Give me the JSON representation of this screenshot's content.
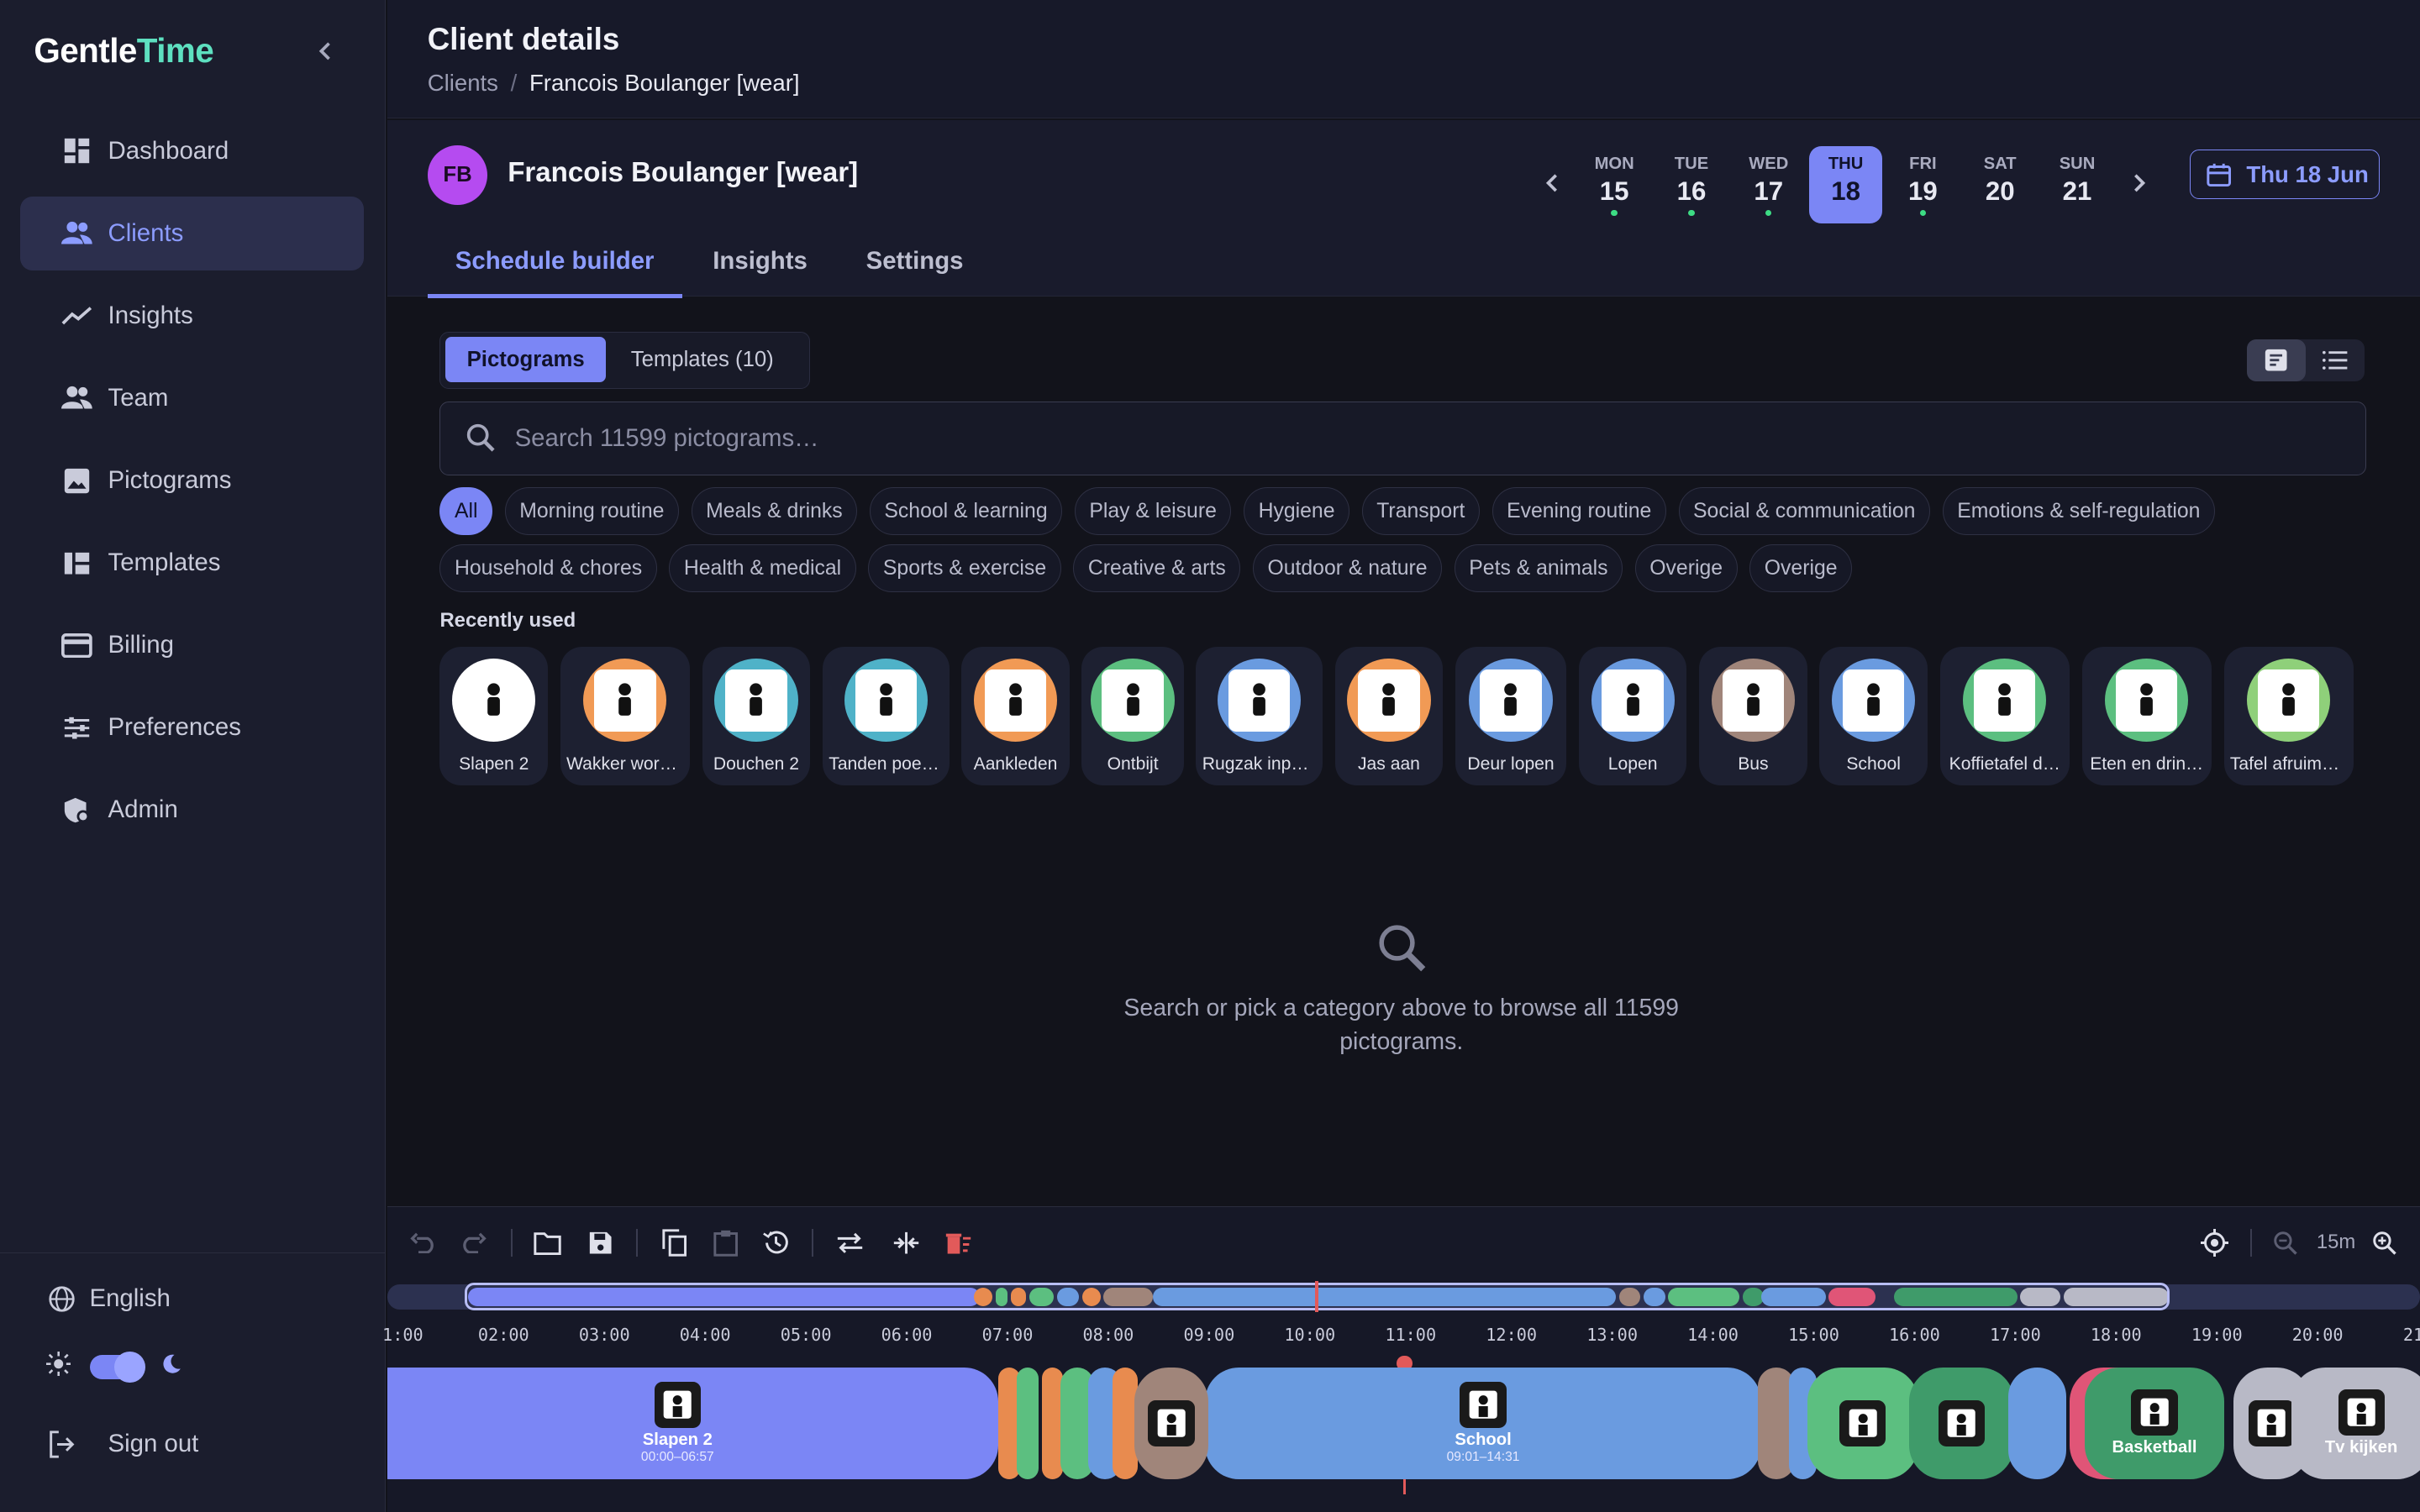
{
  "app": {
    "logo_part1": "Gentle",
    "logo_part2": "Time"
  },
  "sidebar": {
    "items": [
      {
        "label": "Dashboard",
        "icon": "dashboard-icon"
      },
      {
        "label": "Clients",
        "icon": "clients-icon",
        "active": true
      },
      {
        "label": "Insights",
        "icon": "insights-icon"
      },
      {
        "label": "Team",
        "icon": "team-icon"
      },
      {
        "label": "Pictograms",
        "icon": "image-icon"
      },
      {
        "label": "Templates",
        "icon": "templates-icon"
      },
      {
        "label": "Billing",
        "icon": "billing-icon"
      },
      {
        "label": "Preferences",
        "icon": "preferences-icon"
      },
      {
        "label": "Admin",
        "icon": "admin-icon"
      }
    ],
    "language": "English",
    "sign_out": "Sign out"
  },
  "header": {
    "title": "Client details",
    "breadcrumb": {
      "root": "Clients",
      "separator": "/",
      "current": "Francois Boulanger [wear]"
    }
  },
  "client": {
    "initials": "FB",
    "name": "Francois Boulanger [wear]",
    "days": [
      {
        "dow": "MON",
        "num": "15",
        "dot": true
      },
      {
        "dow": "TUE",
        "num": "16",
        "dot": true
      },
      {
        "dow": "WED",
        "num": "17",
        "dot": true
      },
      {
        "dow": "THU",
        "num": "18",
        "dot": false,
        "selected": true
      },
      {
        "dow": "FRI",
        "num": "19",
        "dot": true
      },
      {
        "dow": "SAT",
        "num": "20",
        "dot": false
      },
      {
        "dow": "SUN",
        "num": "21",
        "dot": false
      }
    ],
    "date_button": "Thu 18 Jun",
    "tabs": [
      "Schedule builder",
      "Insights",
      "Settings"
    ]
  },
  "builder": {
    "seg_pictograms": "Pictograms",
    "seg_templates": "Templates (10)",
    "search_placeholder": "Search 11599 pictograms…",
    "categories": [
      "All",
      "Morning routine",
      "Meals & drinks",
      "School & learning",
      "Play & leisure",
      "Hygiene",
      "Transport",
      "Evening routine",
      "Social & communication",
      "Emotions & self-regulation",
      "Household & chores",
      "Health & medical",
      "Sports & exercise",
      "Creative & arts",
      "Outdoor & nature",
      "Pets & animals",
      "Overige",
      "Overige"
    ],
    "recent_label": "Recently used",
    "recent": [
      {
        "label": "Slapen 2",
        "color": "#ffffff"
      },
      {
        "label": "Wakker word…",
        "color": "#f19a55"
      },
      {
        "label": "Douchen 2",
        "color": "#4fb2c8"
      },
      {
        "label": "Tanden poet…",
        "color": "#4fb2c8"
      },
      {
        "label": "Aankleden",
        "color": "#f19a55"
      },
      {
        "label": "Ontbijt",
        "color": "#5cbf80"
      },
      {
        "label": "Rugzak inpa…",
        "color": "#6a9be0"
      },
      {
        "label": "Jas aan",
        "color": "#f19a55"
      },
      {
        "label": "Deur lopen",
        "color": "#6a9be0"
      },
      {
        "label": "Lopen",
        "color": "#6a9be0"
      },
      {
        "label": "Bus",
        "color": "#a0857a"
      },
      {
        "label": "School",
        "color": "#6a9be0"
      },
      {
        "label": "Koffietafel d…",
        "color": "#5cbf80"
      },
      {
        "label": "Eten en drin…",
        "color": "#5cbf80"
      },
      {
        "label": "Tafel afruime…",
        "color": "#8fd07a"
      }
    ],
    "empty_text": "Search or pick a category above to browse all 11599 pictograms."
  },
  "timeline": {
    "zoom": "15m",
    "hours": [
      "1:00",
      "02:00",
      "03:00",
      "04:00",
      "05:00",
      "06:00",
      "07:00",
      "08:00",
      "09:00",
      "10:00",
      "11:00",
      "12:00",
      "13:00",
      "14:00",
      "15:00",
      "16:00",
      "17:00",
      "18:00",
      "19:00",
      "20:00",
      "21:"
    ],
    "blocks": [
      {
        "title": "Slapen 2",
        "time": "00:00–06:57",
        "color": "#7b86f5"
      },
      {
        "title": "",
        "time": "",
        "color": "#e88b4f"
      },
      {
        "title": "",
        "time": "",
        "color": "#5cbf80"
      },
      {
        "title": "",
        "time": "",
        "color": "#e88b4f"
      },
      {
        "title": "",
        "time": "",
        "color": "#5cbf80"
      },
      {
        "title": "",
        "time": "",
        "color": "#6a9be0"
      },
      {
        "title": "",
        "time": "",
        "color": "#e88b4f"
      },
      {
        "title": "",
        "time": "",
        "color": "#a0857a"
      },
      {
        "title": "School",
        "time": "09:01–14:31",
        "color": "#6a9be0"
      },
      {
        "title": "",
        "time": "",
        "color": "#a0857a"
      },
      {
        "title": "",
        "time": "",
        "color": "#6a9be0"
      },
      {
        "title": "",
        "time": "",
        "color": "#5cbf80"
      },
      {
        "title": "",
        "time": "",
        "color": "#3f9b6a"
      },
      {
        "title": "",
        "time": "",
        "color": "#6a9be0"
      },
      {
        "title": "",
        "time": "",
        "color": "#e05577"
      },
      {
        "title": "Basketball",
        "time": "",
        "color": "#3f9b6a"
      },
      {
        "title": "",
        "time": "",
        "color": "#b8b9c6"
      },
      {
        "title": "Tv kijken",
        "time": "",
        "color": "#b8b9c6"
      }
    ]
  }
}
